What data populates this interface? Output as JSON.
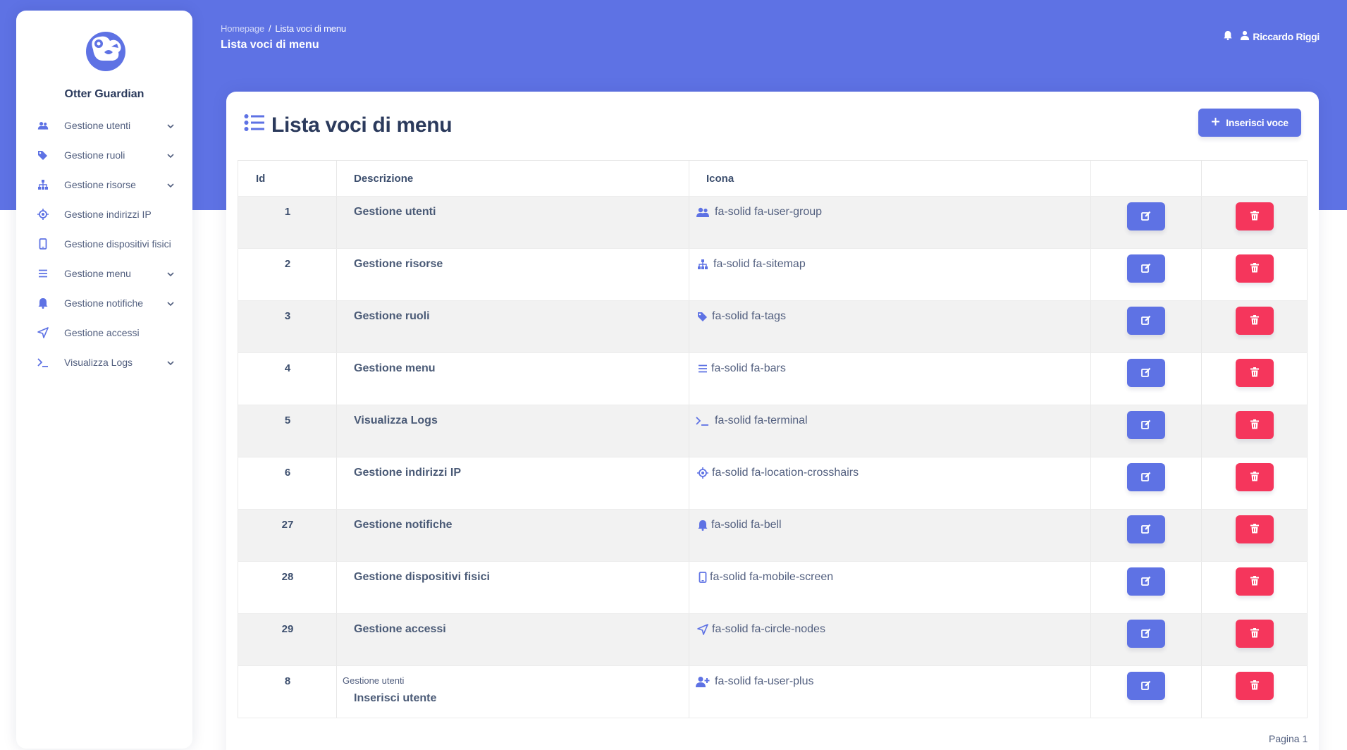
{
  "app": {
    "brand": "Otter Guardian"
  },
  "sidebar": {
    "items": [
      {
        "label": "Gestione utenti",
        "icon": "users-icon",
        "expandable": true
      },
      {
        "label": "Gestione ruoli",
        "icon": "tags-icon",
        "expandable": true
      },
      {
        "label": "Gestione risorse",
        "icon": "sitemap-icon",
        "expandable": true
      },
      {
        "label": "Gestione indirizzi IP",
        "icon": "crosshairs-icon",
        "expandable": false
      },
      {
        "label": "Gestione dispositivi fisici",
        "icon": "mobile-icon",
        "expandable": false
      },
      {
        "label": "Gestione menu",
        "icon": "bars-icon",
        "expandable": true
      },
      {
        "label": "Gestione notifiche",
        "icon": "bell-icon",
        "expandable": true
      },
      {
        "label": "Gestione accessi",
        "icon": "circle-nodes-icon",
        "expandable": false
      },
      {
        "label": "Visualizza Logs",
        "icon": "terminal-icon",
        "expandable": true
      }
    ]
  },
  "header": {
    "breadcrumb_home": "Homepage",
    "breadcrumb_sep": "/",
    "breadcrumb_current": "Lista voci di menu",
    "page_title": "Lista voci di menu",
    "user_name": "Riccardo Riggi"
  },
  "card": {
    "title": "Lista voci di menu",
    "add_button_label": "Inserisci voce"
  },
  "table": {
    "headers": {
      "id": "Id",
      "descrizione": "Descrizione",
      "icona": "Icona"
    },
    "rows": [
      {
        "id": "1",
        "parent": "",
        "descrizione": "Gestione utenti",
        "icona": "fa-solid fa-user-group",
        "icon_name": "users-icon"
      },
      {
        "id": "2",
        "parent": "",
        "descrizione": "Gestione risorse",
        "icona": "fa-solid fa-sitemap",
        "icon_name": "sitemap-icon"
      },
      {
        "id": "3",
        "parent": "",
        "descrizione": "Gestione ruoli",
        "icona": "fa-solid fa-tags",
        "icon_name": "tags-icon"
      },
      {
        "id": "4",
        "parent": "",
        "descrizione": "Gestione menu",
        "icona": "fa-solid fa-bars",
        "icon_name": "bars-icon"
      },
      {
        "id": "5",
        "parent": "",
        "descrizione": "Visualizza Logs",
        "icona": "fa-solid fa-terminal",
        "icon_name": "terminal-icon"
      },
      {
        "id": "6",
        "parent": "",
        "descrizione": "Gestione indirizzi IP",
        "icona": "fa-solid fa-location-crosshairs",
        "icon_name": "crosshairs-icon"
      },
      {
        "id": "27",
        "parent": "",
        "descrizione": "Gestione notifiche",
        "icona": "fa-solid fa-bell",
        "icon_name": "bell-icon"
      },
      {
        "id": "28",
        "parent": "",
        "descrizione": "Gestione dispositivi fisici",
        "icona": "fa-solid fa-mobile-screen",
        "icon_name": "mobile-icon"
      },
      {
        "id": "29",
        "parent": "",
        "descrizione": "Gestione accessi",
        "icona": "fa-solid fa-circle-nodes",
        "icon_name": "circle-nodes-icon"
      },
      {
        "id": "8",
        "parent": "Gestione utenti",
        "descrizione": "Inserisci utente",
        "icona": "fa-solid fa-user-plus",
        "icon_name": "user-plus-icon"
      }
    ]
  },
  "pagination": {
    "label": "Pagina 1"
  },
  "colors": {
    "primary": "#5e72e4",
    "danger": "#f5365c",
    "text": "#525f7f",
    "row_alt": "#f2f2f2"
  }
}
